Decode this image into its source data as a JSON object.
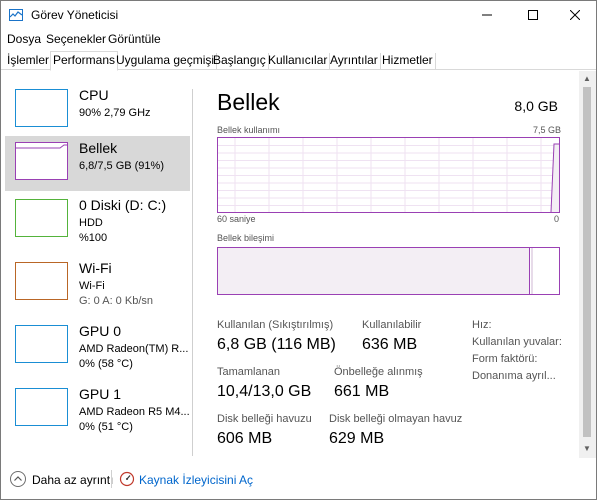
{
  "window": {
    "title": "Görev Yöneticisi"
  },
  "menu": [
    "Dosya",
    "Seçenekler",
    "Görüntüle"
  ],
  "tabs": [
    "İşlemler",
    "Performans",
    "Uygulama geçmişi",
    "Başlangıç",
    "Kullanıcılar",
    "Ayrıntılar",
    "Hizmetler"
  ],
  "active_tab": "Performans",
  "resources": [
    {
      "name": "CPU",
      "line1": "90%  2,79 GHz",
      "line2": "",
      "color": "#1a8ed4"
    },
    {
      "name": "Bellek",
      "line1": "6,8/7,5 GB (91%)",
      "line2": "",
      "color": "#9a40b4"
    },
    {
      "name": "0 Diski (D: C:)",
      "line1": "HDD",
      "line2": "%100",
      "color": "#54b33b"
    },
    {
      "name": "Wi-Fi",
      "line1": "Wi-Fi",
      "line2": "G: 0 A: 0 Kb/sn",
      "color": "#b96626"
    },
    {
      "name": "GPU 0",
      "line1": "AMD Radeon(TM) R...",
      "line2": "0%  (58 °C)",
      "color": "#1a8ed4"
    },
    {
      "name": "GPU 1",
      "line1": "AMD Radeon R5 M4...",
      "line2": "0%  (51 °C)",
      "color": "#1a8ed4"
    }
  ],
  "detail": {
    "title": "Bellek",
    "total": "8,0 GB",
    "usage_label": "Bellek kullanımı",
    "usage_max": "7,5 GB",
    "time_label": "60 saniye",
    "zero_label": "0",
    "composition_label": "Bellek bileşimi",
    "stats": {
      "in_use_label": "Kullanılan (Sıkıştırılmış)",
      "in_use_value": "6,8 GB (116 MB)",
      "available_label": "Kullanılabilir",
      "available_value": "636 MB",
      "committed_label": "Tamamlanan",
      "committed_value": "10,4/13,0 GB",
      "cached_label": "Önbelleğe alınmış",
      "cached_value": "661 MB",
      "paged_label": "Disk belleği havuzu",
      "paged_value": "606 MB",
      "nonpaged_label": "Disk belleği olmayan havuz",
      "nonpaged_value": "629 MB",
      "speed_label": "Hız:",
      "slots_label": "Kullanılan yuvalar:",
      "form_label": "Form faktörü:",
      "reserved_label": "Donanıma ayrıl..."
    }
  },
  "footer": {
    "fewer_details": "Daha az ayrıntı",
    "resource_monitor": "Kaynak İzleyicisini Aç"
  }
}
